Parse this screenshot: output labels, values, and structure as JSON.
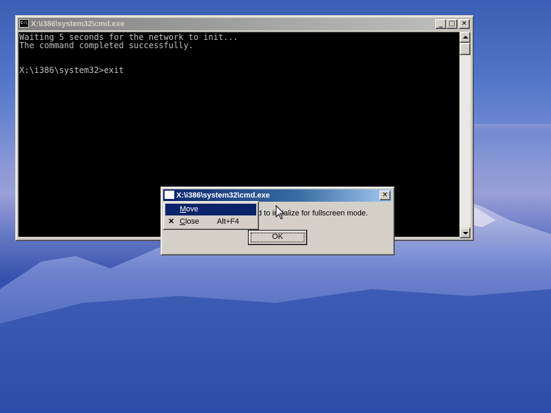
{
  "console_window": {
    "title": "X:\\i386\\system32\\cmd.exe",
    "icon": "cmd-icon",
    "icon_text": "C:\\",
    "buttons": {
      "minimize": "_",
      "maximize": "□",
      "close": "✕"
    },
    "lines": [
      "Waiting 5 seconds for the network to init...",
      "The command completed successfully.",
      "",
      "X:\\i386\\system32>exit"
    ]
  },
  "dialog": {
    "title": "X:\\i386\\system32\\cmd.exe",
    "message": "d to initialize for fullscreen mode.",
    "ok_label": "OK",
    "close_button": "✕"
  },
  "system_menu": {
    "items": [
      {
        "label": "Move",
        "shortcut": "",
        "glyph": "",
        "selected": true
      },
      {
        "label": "Close",
        "shortcut": "Alt+F4",
        "glyph": "✕",
        "selected": false
      }
    ]
  },
  "colors": {
    "title_active": "#0a246a",
    "title_inactive": "#808080",
    "console_bg": "#000000",
    "console_fg": "#c0c0c0",
    "face": "#d4d0c8",
    "selection": "#0a246a"
  }
}
